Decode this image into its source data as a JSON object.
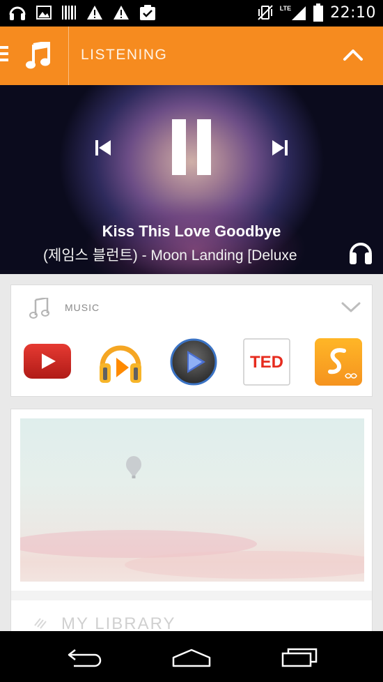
{
  "status_bar": {
    "time": "22:10",
    "network": "LTE",
    "icons": [
      "headphones-icon",
      "image-icon",
      "barcode-icon",
      "warning-icon",
      "warning-icon",
      "clipboard-check-icon",
      "vibrate-icon",
      "signal-icon",
      "battery-icon"
    ]
  },
  "header": {
    "title": "LISTENING",
    "icons": [
      "menu-icon",
      "music-note-icon",
      "chevron-up-icon"
    ],
    "accent_color": "#f68b1f"
  },
  "player": {
    "track_title": "Kiss This Love Goodbye",
    "track_subtitle": "(제임스 블런트) - Moon Landing [Deluxe",
    "controls": [
      "previous-icon",
      "pause-icon",
      "next-icon"
    ],
    "source_icon": "headphones-icon"
  },
  "music_card": {
    "label": "MUSIC",
    "apps": [
      {
        "name": "YouTube",
        "icon": "youtube-icon"
      },
      {
        "name": "Google Play Music",
        "icon": "play-music-icon"
      },
      {
        "name": "Media Player",
        "icon": "media-player-icon"
      },
      {
        "name": "TED",
        "icon": "ted-icon",
        "text": "TED"
      },
      {
        "name": "SoundHound",
        "icon": "soundhound-icon"
      }
    ]
  },
  "library": {
    "label": "MY LIBRARY"
  },
  "nav_bar": {
    "icons": [
      "back-icon",
      "home-icon",
      "recents-icon"
    ]
  }
}
